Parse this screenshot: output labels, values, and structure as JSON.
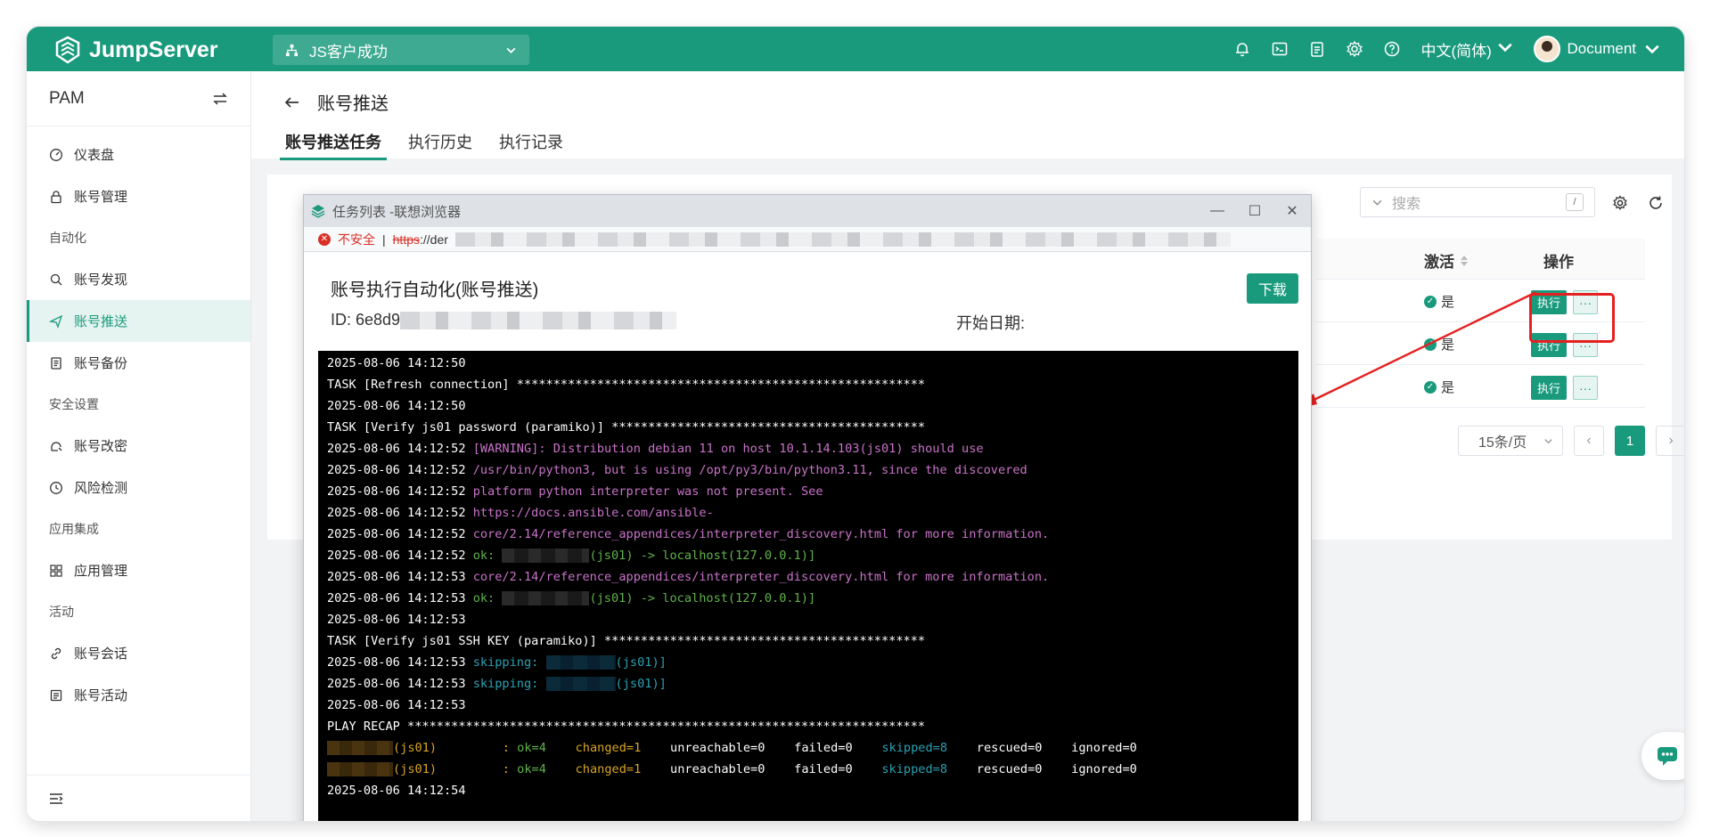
{
  "header": {
    "brand": "JumpServer",
    "org_selector": "JS客户成功",
    "language": "中文(简体)",
    "user": "Document"
  },
  "sidebar": {
    "title": "PAM",
    "items": [
      {
        "label": "仪表盘",
        "icon": "dashboard-icon"
      },
      {
        "label": "账号管理",
        "icon": "lock-icon"
      }
    ],
    "groups": [
      {
        "title": "自动化",
        "items": [
          {
            "label": "账号发现",
            "icon": "search-icon"
          },
          {
            "label": "账号推送",
            "icon": "send-icon",
            "active": true
          },
          {
            "label": "账号备份",
            "icon": "backup-icon"
          }
        ]
      },
      {
        "title": "安全设置",
        "items": [
          {
            "label": "账号改密",
            "icon": "key-icon"
          },
          {
            "label": "风险检测",
            "icon": "risk-icon"
          }
        ]
      },
      {
        "title": "应用集成",
        "items": [
          {
            "label": "应用管理",
            "icon": "apps-icon"
          }
        ]
      },
      {
        "title": "活动",
        "items": [
          {
            "label": "账号会话",
            "icon": "link-icon"
          },
          {
            "label": "账号活动",
            "icon": "activity-icon"
          }
        ]
      }
    ]
  },
  "page": {
    "title": "账号推送",
    "tabs": [
      "账号推送任务",
      "执行历史",
      "执行记录"
    ],
    "search_placeholder": "搜索",
    "search_shortcut": "/",
    "table": {
      "columns": [
        "激活",
        "操作"
      ],
      "rows": [
        {
          "active": "是",
          "exec": "执行",
          "more": "···"
        },
        {
          "active": "是",
          "exec": "执行",
          "more": "···"
        },
        {
          "active": "是",
          "exec": "执行",
          "more": "···"
        }
      ]
    },
    "pagination": {
      "page_size": "15条/页",
      "current": "1"
    }
  },
  "popup": {
    "window_title": "任务列表 -联想浏览器",
    "security_label": "不安全",
    "url_scheme": "https",
    "url_rest": "://der",
    "heading": "账号执行自动化(账号推送)",
    "download": "下载",
    "id_label": "ID: 6e8d9",
    "start_date_label": "开始日期:",
    "log": [
      {
        "t": "2025-08-06 14:12:50",
        "m": "",
        "c": ""
      },
      {
        "t": "TASK [Refresh connection] ********************************************************",
        "m": "",
        "c": ""
      },
      {
        "t": "2025-08-06 14:12:50",
        "m": "",
        "c": ""
      },
      {
        "t": "TASK [Verify js01 password (paramiko)] *******************************************",
        "m": "",
        "c": ""
      },
      {
        "t": "2025-08-06 14:12:52 ",
        "m": "[WARNING]: Distribution debian 11 on host 10.1.14.103(js01) should use",
        "c": "pur"
      },
      {
        "t": "2025-08-06 14:12:52 ",
        "m": "/usr/bin/python3, but is using /opt/py3/bin/python3.11, since the discovered",
        "c": "pur"
      },
      {
        "t": "2025-08-06 14:12:52 ",
        "m": "platform python interpreter was not present. See",
        "c": "pur"
      },
      {
        "t": "2025-08-06 14:12:52 ",
        "m": "https://docs.ansible.com/ansible-",
        "c": "pur"
      },
      {
        "t": "2025-08-06 14:12:52 ",
        "m": "core/2.14/reference_appendices/interpreter_discovery.html for more information.",
        "c": "pur"
      },
      {
        "t": "2025-08-06 14:12:52 ",
        "m": "ok: ",
        "c": "grn",
        "blur": true,
        "tail": "(js01) -> localhost(127.0.0.1)]"
      },
      {
        "t": "2025-08-06 14:12:53 ",
        "m": "core/2.14/reference_appendices/interpreter_discovery.html for more information.",
        "c": "pur"
      },
      {
        "t": "2025-08-06 14:12:53 ",
        "m": "ok: ",
        "c": "grn",
        "blur": true,
        "tail": "(js01) -> localhost(127.0.0.1)]"
      },
      {
        "t": "2025-08-06 14:12:53",
        "m": "",
        "c": ""
      },
      {
        "t": "TASK [Verify js01 SSH KEY (paramiko)] ********************************************",
        "m": "",
        "c": ""
      },
      {
        "t": "2025-08-06 14:12:53 ",
        "m": "skipping: ",
        "c": "cyn",
        "blur": true,
        "tail": "(js01)]"
      },
      {
        "t": "2025-08-06 14:12:53 ",
        "m": "skipping: ",
        "c": "cyn",
        "blur": true,
        "tail": "(js01)]"
      },
      {
        "t": "2025-08-06 14:12:53",
        "m": "",
        "c": ""
      },
      {
        "t": "PLAY RECAP ***********************************************************************",
        "m": "",
        "c": ""
      }
    ],
    "recap": [
      {
        "host": "(js01)",
        "ok": "ok=4",
        "changed": "changed=1",
        "unreachable": "unreachable=0",
        "failed": "failed=0",
        "skipped": "skipped=8",
        "rescued": "rescued=0",
        "ignored": "ignored=0"
      },
      {
        "host": "(js01)",
        "ok": "ok=4",
        "changed": "changed=1",
        "unreachable": "unreachable=0",
        "failed": "failed=0",
        "skipped": "skipped=8",
        "rescued": "rescued=0",
        "ignored": "ignored=0"
      }
    ],
    "log_end": "2025-08-06 14:12:54",
    "separator": "--------------------------------------------------------------------------------"
  },
  "colors": {
    "brand": "#1a9a7d",
    "annotation": "#e52020"
  }
}
